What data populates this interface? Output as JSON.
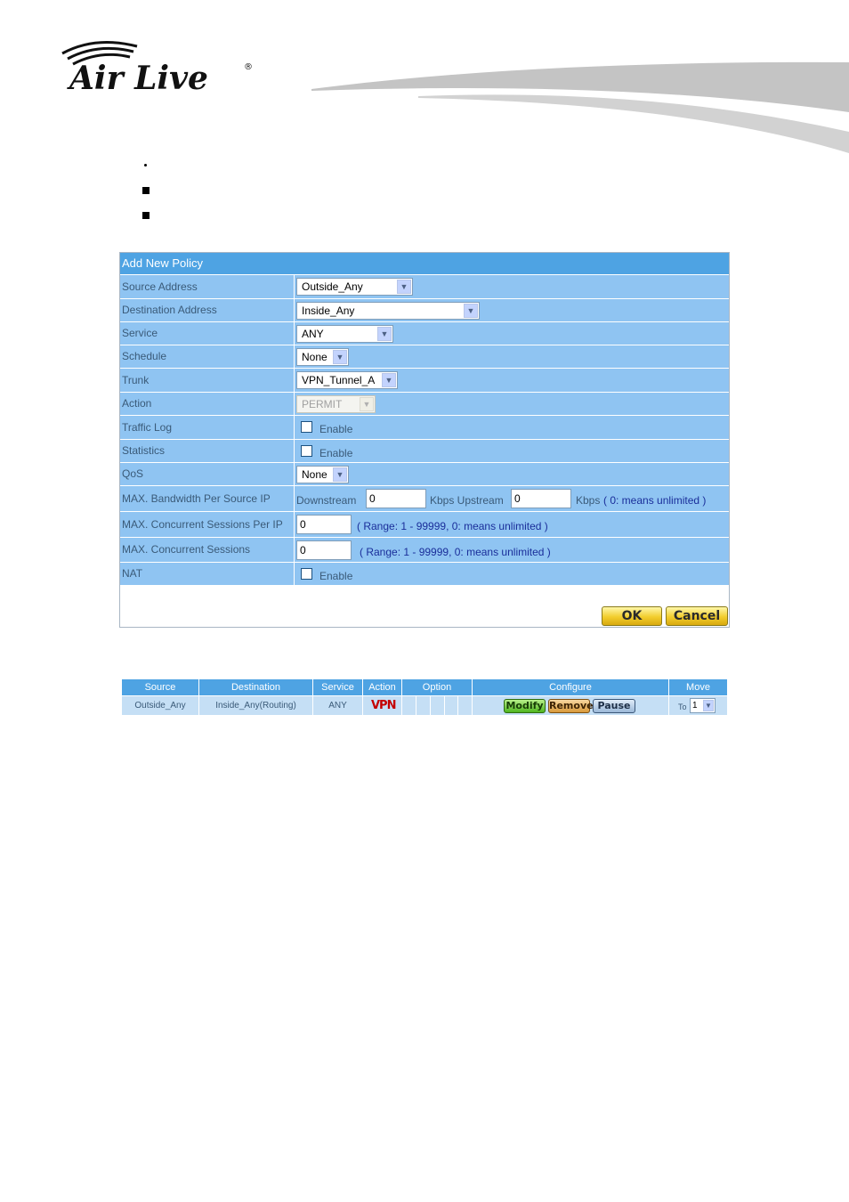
{
  "brand": {
    "name": "Air Live"
  },
  "form": {
    "title": "Add New Policy",
    "rows": {
      "source_address": {
        "label": "Source Address",
        "value": "Outside_Any"
      },
      "destination_address": {
        "label": "Destination Address",
        "value": "Inside_Any"
      },
      "service": {
        "label": "Service",
        "value": "ANY"
      },
      "schedule": {
        "label": "Schedule",
        "value": "None"
      },
      "trunk": {
        "label": "Trunk",
        "value": "VPN_Tunnel_A"
      },
      "action": {
        "label": "Action",
        "value": "PERMIT"
      },
      "traffic_log": {
        "label": "Traffic Log",
        "checkbox_label": "Enable",
        "checked": false
      },
      "statistics": {
        "label": "Statistics",
        "checkbox_label": "Enable",
        "checked": false
      },
      "qos": {
        "label": "QoS",
        "value": "None"
      },
      "max_bandwidth": {
        "label": "MAX. Bandwidth Per Source IP",
        "downstream_label": "Downstream",
        "downstream_value": "0",
        "upstream_label": "Kbps Upstream",
        "upstream_value": "0",
        "unit_label": "Kbps",
        "hint": "( 0: means unlimited )"
      },
      "max_sessions_per_ip": {
        "label": "MAX. Concurrent Sessions Per IP",
        "value": "0",
        "hint": "( Range: 1 - 99999, 0: means unlimited )"
      },
      "max_sessions": {
        "label": "MAX. Concurrent Sessions",
        "value": "0",
        "hint": "( Range: 1 - 99999, 0: means unlimited )"
      },
      "nat": {
        "label": "NAT",
        "checkbox_label": "Enable",
        "checked": false
      }
    },
    "ok_label": "OK",
    "cancel_label": "Cancel"
  },
  "policy_table": {
    "headers": [
      "Source",
      "Destination",
      "Service",
      "Action",
      "Option",
      "Configure",
      "Move"
    ],
    "row": {
      "source": "Outside_Any",
      "destination": "Inside_Any(Routing)",
      "service": "ANY",
      "action": "VPN",
      "modify_label": "Modify",
      "remove_label": "Remove",
      "pause_label": "Pause",
      "move_prefix": "To",
      "move_value": "1"
    }
  },
  "colors": {
    "header_blue": "#4ea3e3",
    "row_blue": "#8fc4f2",
    "hint_blue": "#1a2e9a",
    "vpn_red": "#c40000"
  }
}
